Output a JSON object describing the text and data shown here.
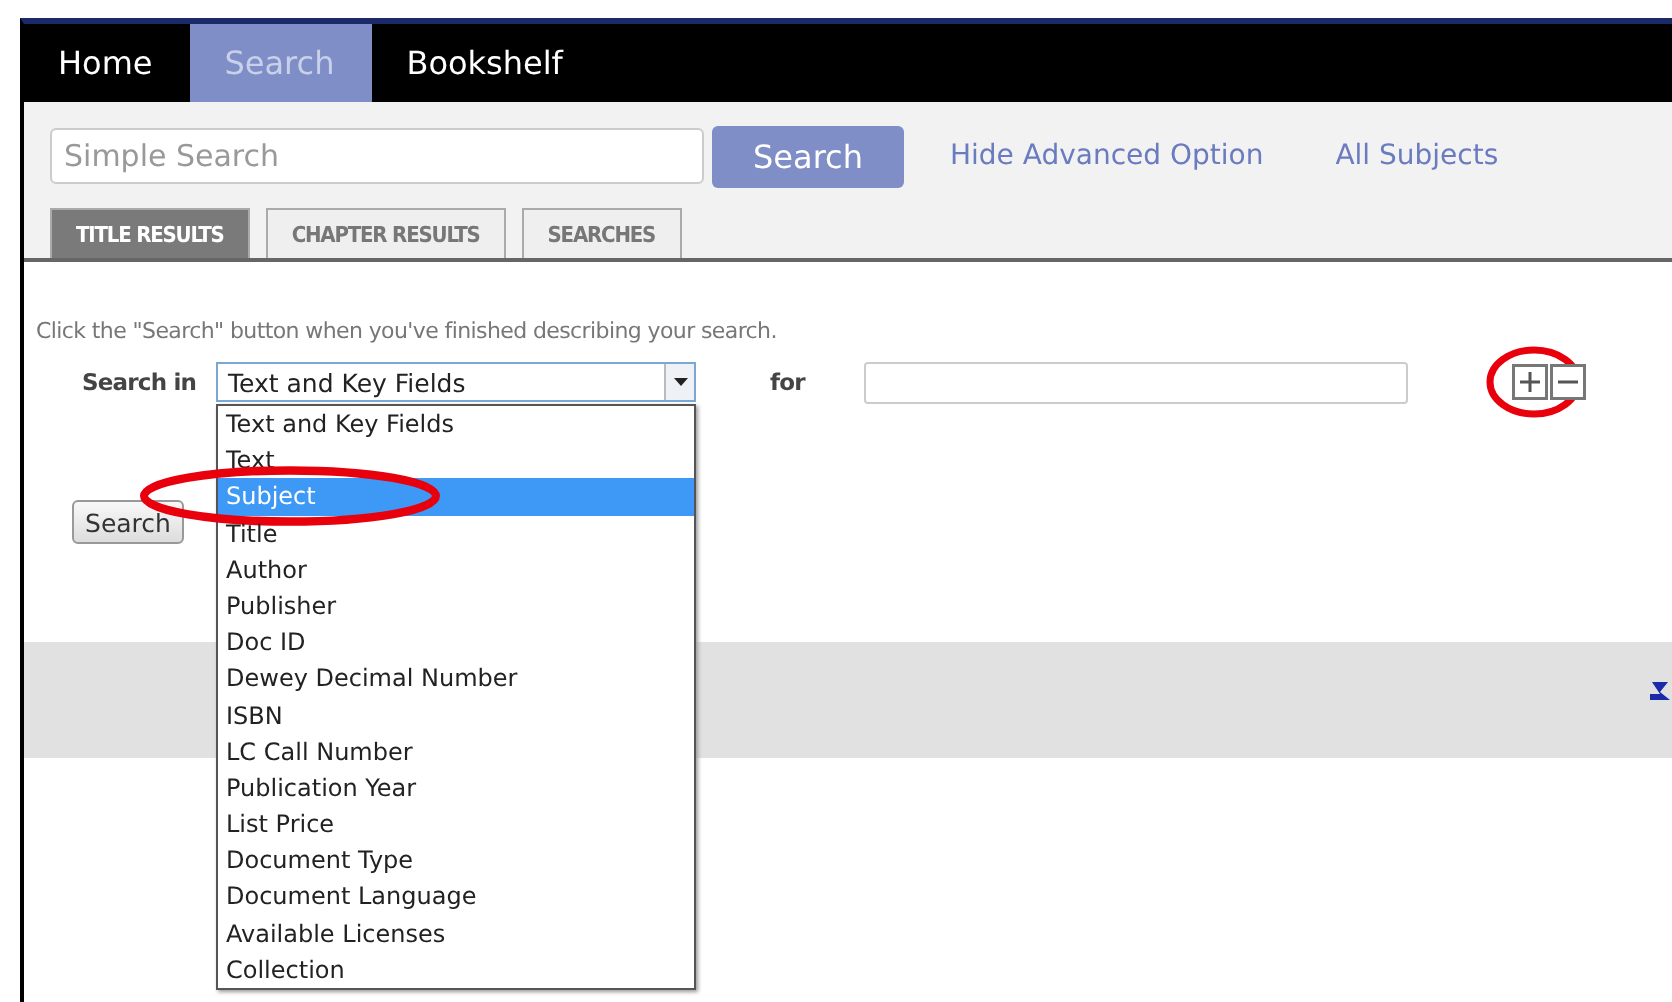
{
  "nav": [
    {
      "label": "Home",
      "selected": false
    },
    {
      "label": "Search",
      "selected": true
    },
    {
      "label": "Bookshelf",
      "selected": false
    }
  ],
  "simple_search": {
    "placeholder": "Simple Search",
    "button": "Search"
  },
  "links": [
    "Hide Advanced Option",
    "All Subjects"
  ],
  "tabs": [
    {
      "label": "TITLE RESULTS",
      "selected": true
    },
    {
      "label": "CHAPTER RESULTS",
      "selected": false
    },
    {
      "label": "SEARCHES",
      "selected": false
    }
  ],
  "instruction": "Click the \"Search\" button when you've finished describing your search.",
  "search_in": {
    "label": "Search in",
    "value": "Text and Key Fields",
    "expanded": true
  },
  "for": {
    "label": "for"
  },
  "row_buttons": [
    {
      "kind": "add",
      "circled": true
    },
    {
      "kind": "remove",
      "circled": false
    }
  ],
  "search_button": "Search",
  "options": [
    {
      "label": "Text and Key Fields",
      "selected": false,
      "circled": false
    },
    {
      "label": "Text",
      "selected": false,
      "circled": false
    },
    {
      "label": "Subject",
      "selected": true,
      "circled": true
    },
    {
      "label": "Title",
      "selected": false,
      "circled": false
    },
    {
      "label": "Author",
      "selected": false,
      "circled": false
    },
    {
      "label": "Publisher",
      "selected": false,
      "circled": false
    },
    {
      "label": "Doc ID",
      "selected": false,
      "circled": false
    },
    {
      "label": "Dewey Decimal Number",
      "selected": false,
      "circled": false
    },
    {
      "label": "ISBN",
      "selected": false,
      "circled": false
    },
    {
      "label": "LC Call Number",
      "selected": false,
      "circled": false
    },
    {
      "label": "Publication Year",
      "selected": false,
      "circled": false
    },
    {
      "label": "List Price",
      "selected": false,
      "circled": false
    },
    {
      "label": "Document Type",
      "selected": false,
      "circled": false
    },
    {
      "label": "Document Language",
      "selected": false,
      "circled": false
    },
    {
      "label": "Available Licenses",
      "selected": false,
      "circled": false
    },
    {
      "label": "Collection",
      "selected": false,
      "circled": false
    }
  ]
}
